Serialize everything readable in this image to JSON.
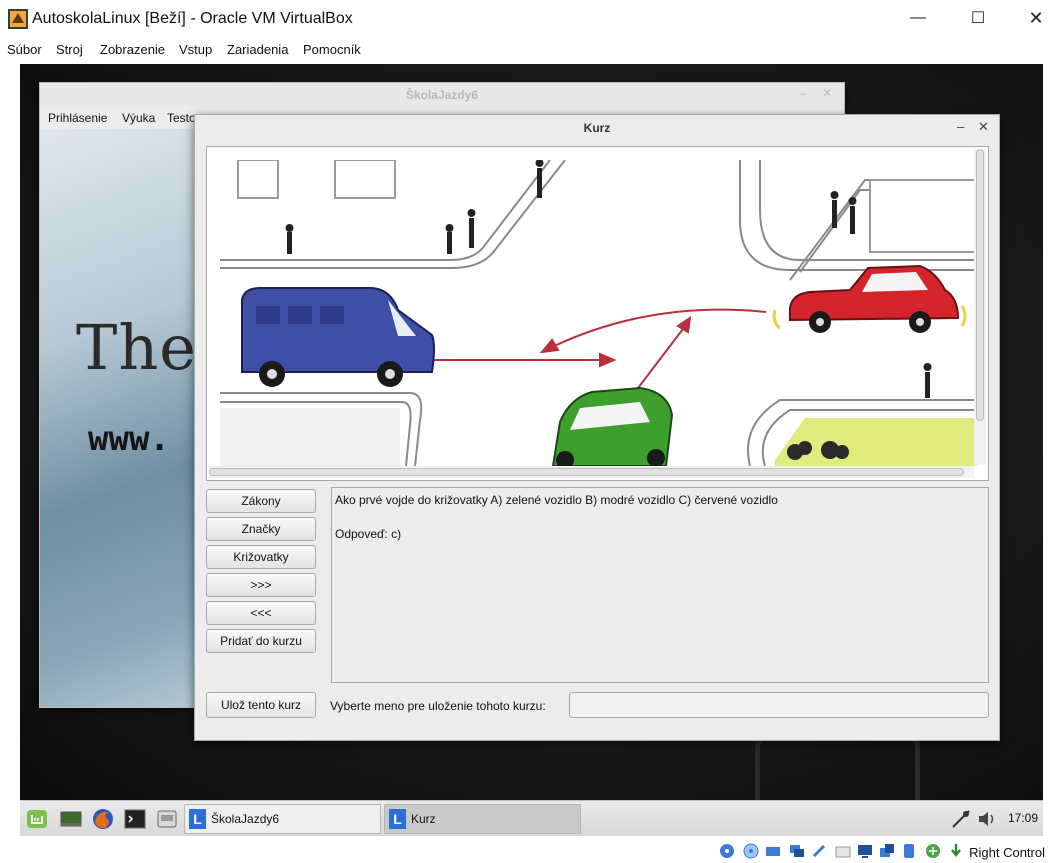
{
  "host": {
    "title": "AutoskolaLinux [Beží] - Oracle VM VirtualBox",
    "menu": [
      "Súbor",
      "Stroj",
      "Zobrazenie",
      "Vstup",
      "Zariadenia",
      "Pomocník"
    ],
    "status_host_key": "Right Control"
  },
  "skola": {
    "title": "ŠkolaJazdy6",
    "menu": [
      "Prihlásenie",
      "Výuka",
      "Testo"
    ],
    "splash_line1": "The",
    "splash_line2": "www."
  },
  "kurz": {
    "title": "Kurz",
    "buttons": [
      "Zákony",
      "Značky",
      "Križovatky",
      ">>>",
      "<<<",
      "Pridať do kurzu"
    ],
    "save_button": "Ulož tento kurz",
    "question": "Ako prvé vojde do križovatky A) zelené vozidlo B) modré vozidlo C) červené vozidlo",
    "answer": "Odpoveď: c)",
    "save_label": "Vyberte meno pre uloženie tohoto kurzu:",
    "save_input_value": ""
  },
  "taskbar": {
    "tasks": [
      "ŠkolaJazdy6",
      "Kurz"
    ],
    "clock": "17:09"
  },
  "colors": {
    "van_blue": "#3f4fa8",
    "car_red": "#d4242b",
    "car_green": "#3e9f2e",
    "arrow_red": "#b8303c",
    "grass": "#dfeb7c"
  }
}
